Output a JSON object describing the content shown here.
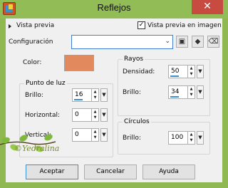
{
  "window": {
    "title": "Reflejos",
    "close_symbol": "✕",
    "app_icon": "paint-shop-icon",
    "colors": {
      "frame": "#8fb853",
      "close": "#c74b40",
      "accent": "#3c8fd0"
    }
  },
  "preview": {
    "label": "Vista previa",
    "image_preview_label": "Vista previa en imagen",
    "image_preview_checked": true
  },
  "config": {
    "label": "Configuración",
    "value": "",
    "chevron": "⌄",
    "icons": [
      "save-icon",
      "cube-icon",
      "delete-icon"
    ]
  },
  "color": {
    "label": "Color:",
    "swatch": "#e2895e"
  },
  "punto_de_luz": {
    "title": "Punto de luz",
    "fields": [
      {
        "label": "Brillo:",
        "value": "16"
      },
      {
        "label": "Horizontal:",
        "value": "0"
      },
      {
        "label": "Vertical:",
        "value": "0"
      }
    ]
  },
  "rayos": {
    "title": "Rayos",
    "fields": [
      {
        "label": "Densidad:",
        "value": "50"
      },
      {
        "label": "Brillo:",
        "value": "34"
      }
    ]
  },
  "circulos": {
    "title": "Círculos",
    "fields": [
      {
        "label": "Brillo:",
        "value": "100"
      }
    ]
  },
  "buttons": {
    "ok": "Aceptar",
    "cancel": "Cancelar",
    "help": "Ayuda"
  },
  "watermark": "©Yedralina"
}
